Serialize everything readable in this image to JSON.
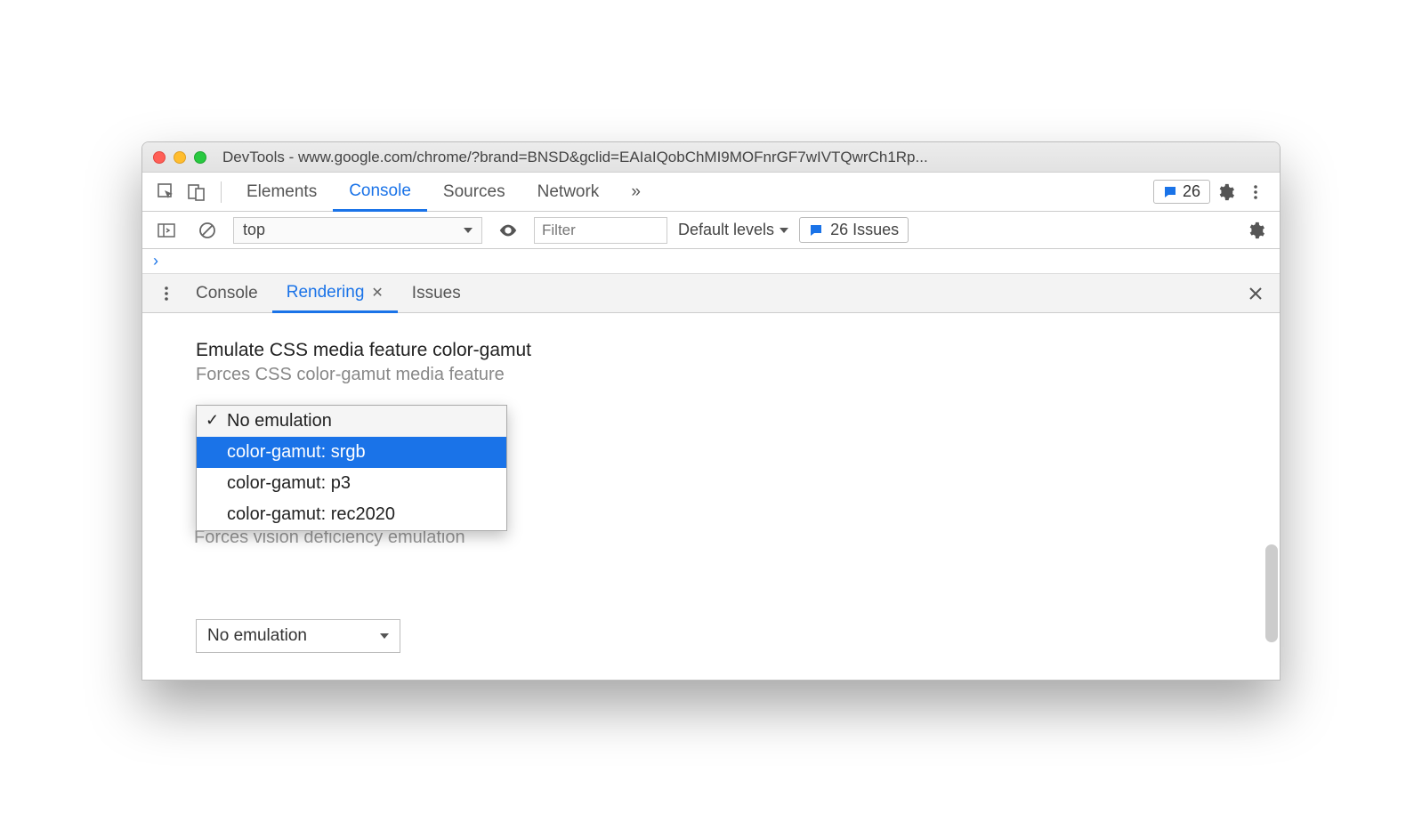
{
  "window": {
    "title": "DevTools - www.google.com/chrome/?brand=BNSD&gclid=EAIaIQobChMI9MOFnrGF7wIVTQwrCh1Rp..."
  },
  "main_tabs": {
    "items": [
      "Elements",
      "Console",
      "Sources",
      "Network"
    ],
    "active_index": 1,
    "more_indicator": "»",
    "issues_count": "26"
  },
  "console_toolbar": {
    "context": "top",
    "filter_placeholder": "Filter",
    "levels_label": "Default levels",
    "issues_label": "26 Issues"
  },
  "prompt": "›",
  "drawer_tabs": {
    "items": [
      "Console",
      "Rendering",
      "Issues"
    ],
    "active_index": 1
  },
  "rendering": {
    "setting_title": "Emulate CSS media feature color-gamut",
    "setting_subtitle": "Forces CSS color-gamut media feature",
    "dropdown": {
      "options": [
        "No emulation",
        "color-gamut: srgb",
        "color-gamut: p3",
        "color-gamut: rec2020"
      ],
      "checked_index": 0,
      "highlight_index": 1
    },
    "obscured_subtitle": "Forces vision deficiency emulation",
    "second_select": "No emulation"
  }
}
